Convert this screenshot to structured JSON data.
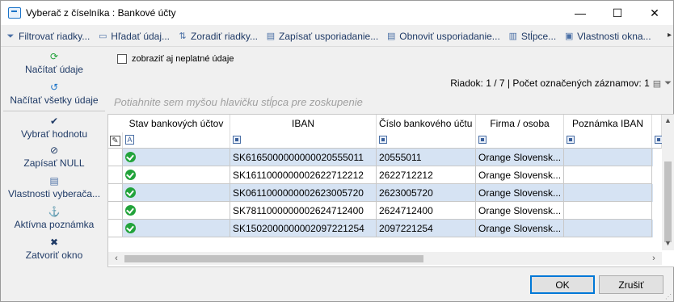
{
  "window": {
    "title": "Vyberač z číselníka : Bankové účty",
    "minimize": "—",
    "maximize": "☐",
    "close": "✕"
  },
  "toolbar": {
    "items": [
      {
        "label": "Filtrovať riadky...",
        "icon": "⏷"
      },
      {
        "label": "Hľadať údaj...",
        "icon": "▭"
      },
      {
        "label": "Zoradiť riadky...",
        "icon": "⇅"
      },
      {
        "label": "Zapísať usporiadanie...",
        "icon": "▤"
      },
      {
        "label": "Obnoviť usporiadanie...",
        "icon": "▤"
      },
      {
        "label": "Stĺpce...",
        "icon": "▥"
      },
      {
        "label": "Vlastnosti okna...",
        "icon": "▣"
      }
    ],
    "overflow": "▸"
  },
  "left_panel": {
    "items": [
      {
        "label": "Načítať údaje",
        "icon": "⟳"
      },
      {
        "label": "Načítať všetky údaje",
        "icon": "↺"
      },
      {
        "label": "Vybrať hodnotu",
        "icon": "✔"
      },
      {
        "label": "Zapísať NULL",
        "icon": "⊘"
      },
      {
        "label": "Vlastnosti vyberača...",
        "icon": "▤"
      },
      {
        "label": "Aktívna poznámka",
        "icon": "⚓"
      },
      {
        "label": "Zatvoriť okno",
        "icon": "✖"
      }
    ]
  },
  "options": {
    "show_invalid_label": "zobraziť aj neplatné údaje"
  },
  "status": {
    "text": "Riadok: 1 / 7 | Počet označených záznamov: 1"
  },
  "group_hint": "Potiahnite sem myšou hlavičku stĺpca pre zoskupenie",
  "grid": {
    "columns": [
      "Stav bankových účtov",
      "IBAN",
      "Číslo bankového účtu",
      "Firma / osoba",
      "Poznámka IBAN"
    ],
    "rows": [
      {
        "iban": "SK6165000000000020555011",
        "account": "20555011",
        "firm": "Orange Slovensk...",
        "note": ""
      },
      {
        "iban": "SK1611000000002622712212",
        "account": "2622712212",
        "firm": "Orange Slovensk...",
        "note": ""
      },
      {
        "iban": "SK0611000000002623005720",
        "account": "2623005720",
        "firm": "Orange Slovensk...",
        "note": ""
      },
      {
        "iban": "SK7811000000002624712400",
        "account": "2624712400",
        "firm": "Orange Slovensk...",
        "note": ""
      },
      {
        "iban": "SK1502000000002097221254",
        "account": "2097221254",
        "firm": "Orange Slovensk...",
        "note": ""
      }
    ]
  },
  "buttons": {
    "ok": "OK",
    "cancel": "Zrušiť"
  }
}
